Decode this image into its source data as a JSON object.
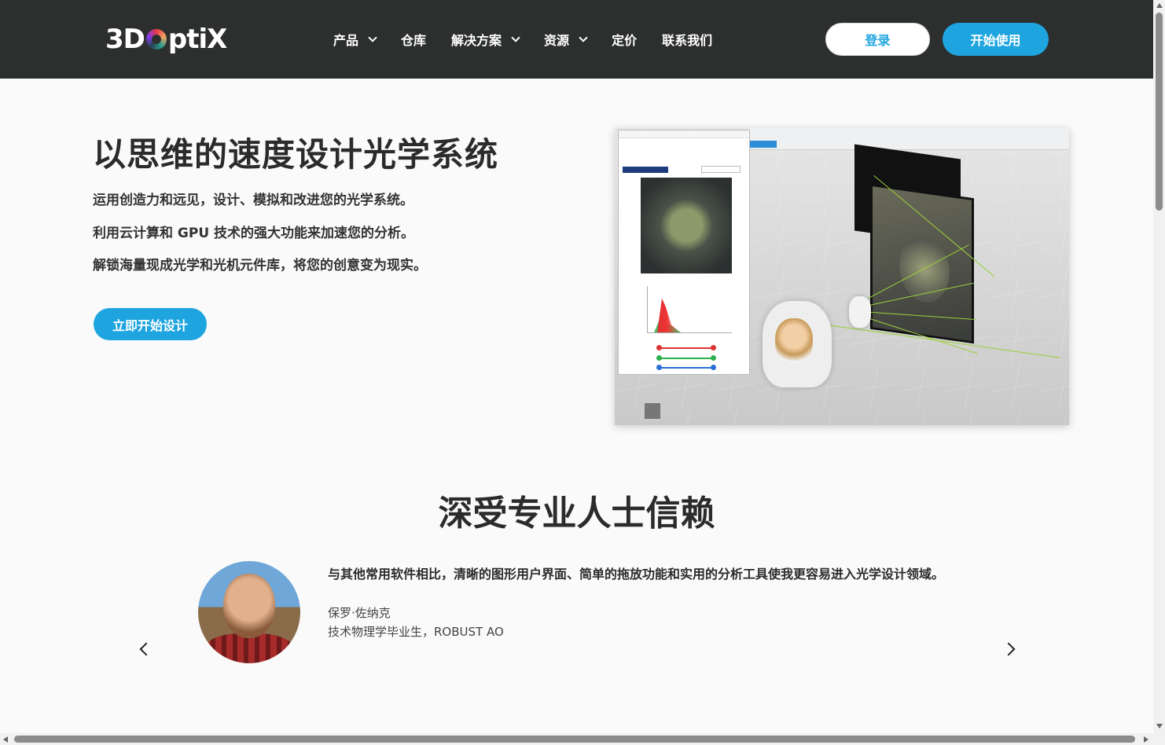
{
  "header": {
    "logo_text": "3Doptix",
    "nav": [
      {
        "label": "产品",
        "has_dropdown": true
      },
      {
        "label": "仓库",
        "has_dropdown": false
      },
      {
        "label": "解决方案",
        "has_dropdown": true
      },
      {
        "label": "资源",
        "has_dropdown": true
      },
      {
        "label": "定价",
        "has_dropdown": false
      },
      {
        "label": "联系我们",
        "has_dropdown": false
      }
    ],
    "login_label": "登录",
    "start_label": "开始使用"
  },
  "hero": {
    "title": "以思维的速度设计光学系统",
    "lines": [
      "运用创造力和远见，设计、模拟和改进您的光学系统。",
      "利用云计算和 GPU 技术的强大功能来加速您的分析。",
      "解锁海量现成光学和光机元件库，将您的创意变为现实。"
    ],
    "cta_label": "立即开始设计",
    "screenshot_icon": "optical-simulation-screenshot"
  },
  "testimonials": {
    "title": "深受专业人士信赖",
    "current": {
      "quote": "与其他常用软件相比，清晰的图形用户界面、简单的拖放功能和实用的分析工具使我更容易进入光学设计领域。",
      "author": "保罗·佐纳克",
      "role": "技术物理学毕业生，ROBUST AO"
    }
  },
  "colors": {
    "header_bg": "#2d2f2f",
    "accent": "#1ea5e0",
    "page_bg": "#fafafa"
  }
}
